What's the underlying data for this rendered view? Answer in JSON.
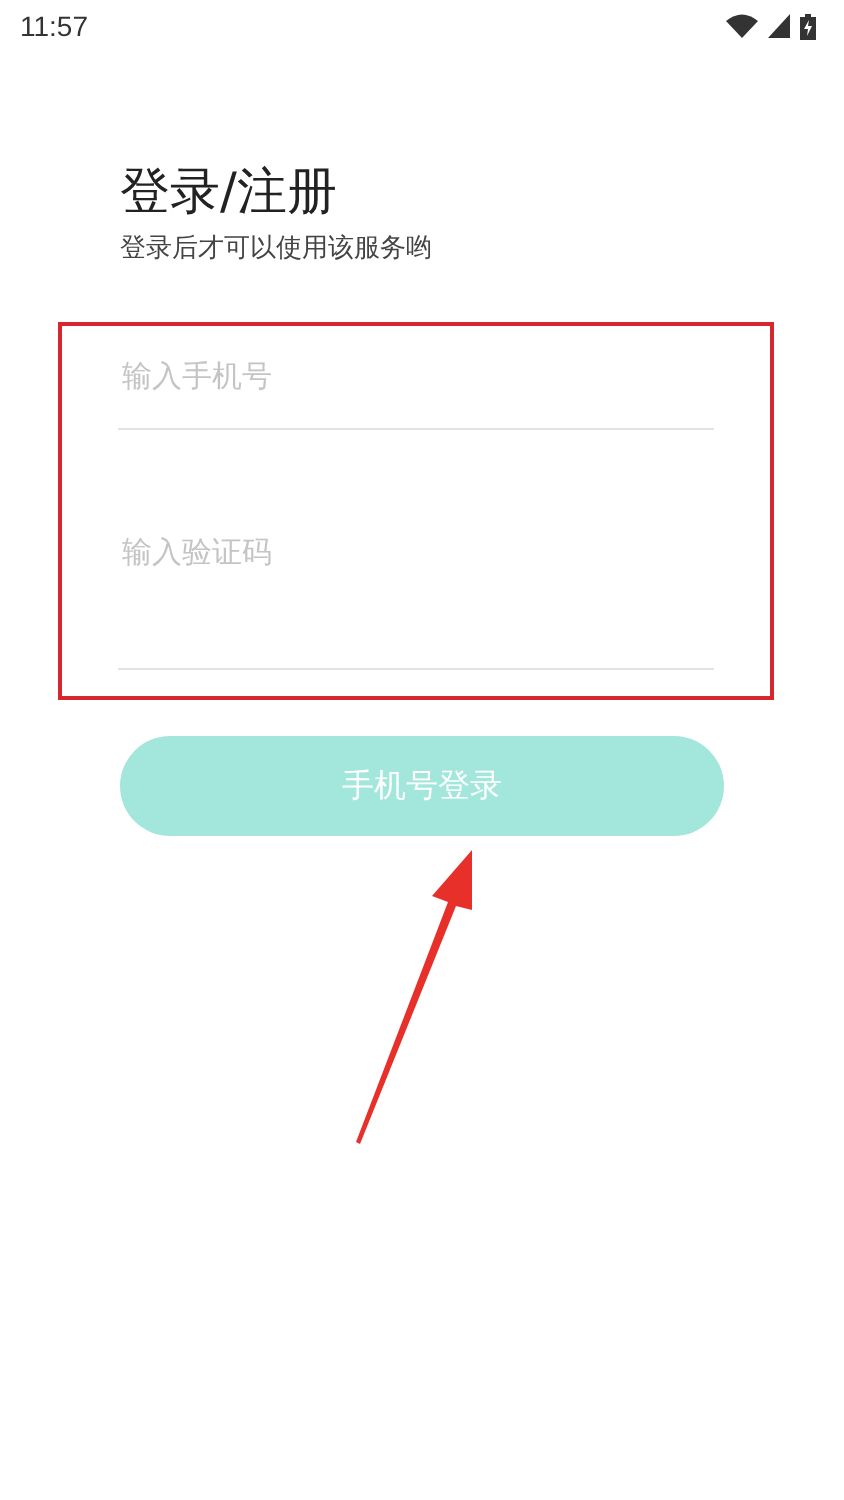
{
  "status_bar": {
    "time": "11:57"
  },
  "title": "登录/注册",
  "subtitle": "登录后才可以使用该服务哟",
  "fields": [
    {
      "placeholder": "输入手机号"
    },
    {
      "placeholder": "输入验证码"
    }
  ],
  "login_button": {
    "label": "手机号登录",
    "disabled": true
  }
}
